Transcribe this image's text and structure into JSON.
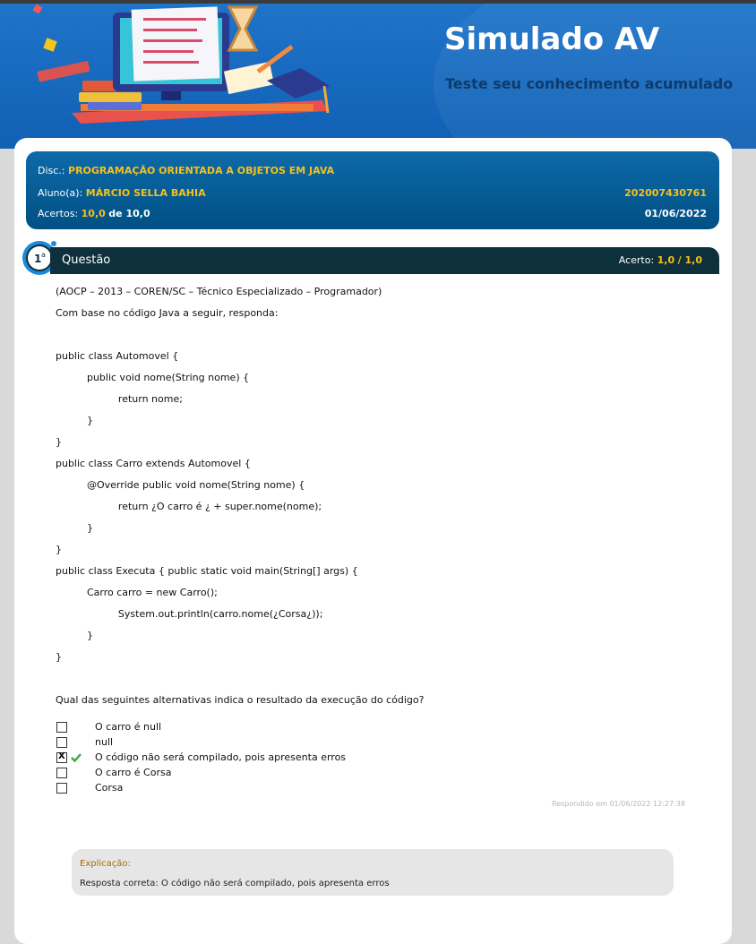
{
  "banner": {
    "title": "Simulado AV",
    "subtitle": "Teste seu conhecimento acumulado"
  },
  "info": {
    "disc_label": "Disc.:",
    "disc_value": "PROGRAMAÇÃO ORIENTADA A OBJETOS EM JAVA",
    "aluno_label": "Aluno(a):",
    "aluno_value": "MÁRCIO SELLA BAHIA",
    "matricula": "202007430761",
    "acertos_label": "Acertos:",
    "acertos_value": "10,0",
    "acertos_de": "de 10,0",
    "date": "01/06/2022"
  },
  "question": {
    "number": "1",
    "number_sup": "a",
    "label": "Questão",
    "acerto_label": "Acerto:",
    "acerto_value": "1,0",
    "acerto_total": "/ 1,0",
    "lines": [
      "(AOCP – 2013 – COREN/SC – Técnico Especializado – Programador)",
      "Com base no código Java a seguir, responda:",
      "public class Automovel {",
      "          public void nome(String nome) {",
      "                    return nome;",
      "          }",
      "}",
      "public class Carro extends Automovel {",
      "          @Override public void nome(String nome) {",
      "                    return ¿O carro é ¿ + super.nome(nome);",
      "          }",
      "}",
      "public class Executa { public static void main(String[] args) {",
      "          Carro carro = new Carro();",
      "                    System.out.println(carro.nome(¿Corsa¿));",
      "          }",
      "}",
      "Qual das seguintes alternativas indica o resultado da execução do código?"
    ],
    "options": [
      {
        "label": "O carro é null",
        "checked": false
      },
      {
        "label": "null",
        "checked": false
      },
      {
        "label": "O código não será compilado, pois apresenta erros",
        "checked": true
      },
      {
        "label": "O carro é Corsa",
        "checked": false
      },
      {
        "label": "Corsa",
        "checked": false
      }
    ],
    "answered_at": "Respondido em 01/06/2022 12:27:38"
  },
  "explanation": {
    "title": "Explicação:",
    "text": "Resposta correta: O código não será compilado, pois apresenta erros"
  },
  "colors": {
    "banner_blue": "#1f74c9",
    "info_blue": "#005084",
    "question_bar": "#0e2f3c",
    "highlight_yellow": "#f7c11a",
    "correct_green": "#3aa935"
  }
}
